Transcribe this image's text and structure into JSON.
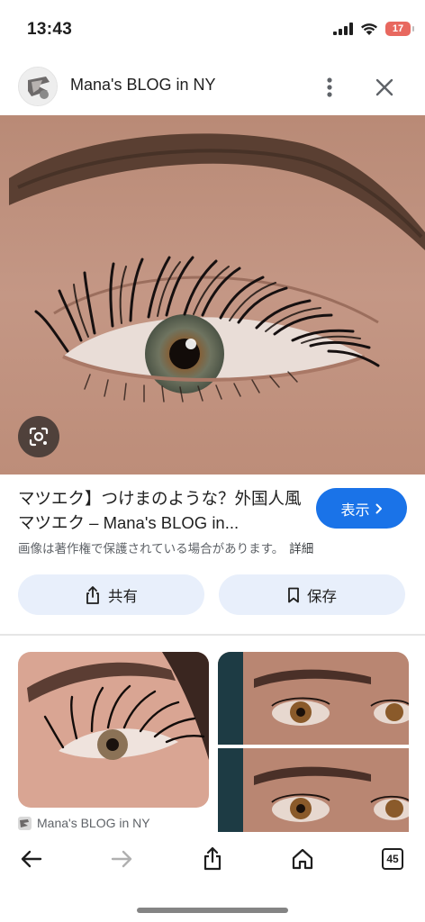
{
  "status": {
    "time": "13:43",
    "battery": "17"
  },
  "header": {
    "site_name": "Mana's BLOG in NY"
  },
  "result": {
    "title": "マツエク】つけまのような？外国人風マツエク – Mana's BLOG in...",
    "visit_label": "表示",
    "copyright_notice": "画像は著作権で保護されている場合があります。",
    "details_label": "詳細",
    "share_label": "共有",
    "save_label": "保存"
  },
  "related": {
    "caption": "Mana's BLOG in NY"
  },
  "toolbar": {
    "tabs_count": "45"
  },
  "colors": {
    "accent": "#1a73e8",
    "pill_bg": "#e8effb",
    "battery": "#e8685f"
  },
  "icons": [
    "signal-icon",
    "wifi-icon",
    "battery-icon",
    "more-vert-icon",
    "close-icon",
    "lens-icon",
    "chevron-right-icon",
    "share-icon",
    "bookmark-icon",
    "back-icon",
    "forward-icon",
    "home-icon",
    "tabs-icon"
  ]
}
